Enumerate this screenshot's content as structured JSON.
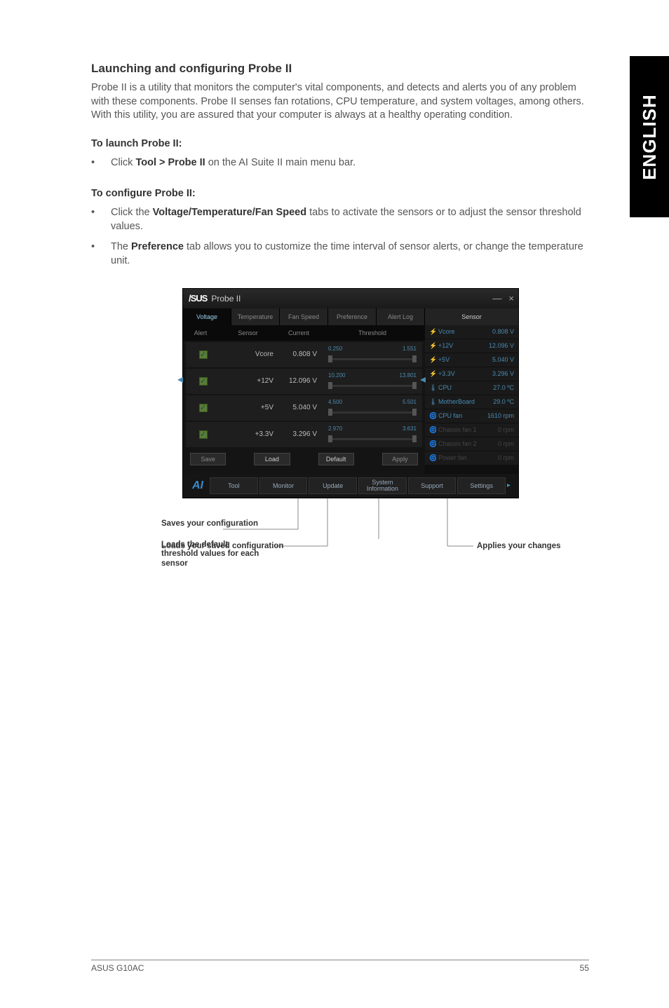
{
  "side_tab": "ENGLISH",
  "heading": "Launching and configuring Probe II",
  "intro": "Probe II is a utility that monitors the computer's vital components, and detects and alerts you of any problem with these components. Probe II senses fan rotations, CPU temperature, and system voltages, among others. With this utility, you are assured that your computer is always at a healthy operating condition.",
  "launch_head": "To launch Probe II:",
  "launch_item_prefix": "Click ",
  "launch_item_bold": "Tool > Probe II",
  "launch_item_suffix": " on the AI Suite II main menu bar.",
  "config_head": "To configure Probe II:",
  "config_item1_prefix": "Click the ",
  "config_item1_bold": "Voltage/Temperature/Fan Speed",
  "config_item1_suffix": " tabs to activate the sensors or to adjust the sensor threshold values.",
  "config_item2_prefix": "The ",
  "config_item2_bold": "Preference",
  "config_item2_suffix": " tab allows you to customize the time interval of sensor alerts, or change the temperature unit.",
  "probe": {
    "logo": "/SUS",
    "title": "Probe II",
    "min": "—",
    "close": "×",
    "tabs": [
      "Voltage",
      "Temperature",
      "Fan Speed",
      "Preference",
      "Alert Log"
    ],
    "cols": {
      "alert": "Alert",
      "sensor": "Sensor",
      "current": "Current",
      "threshold": "Threshold"
    },
    "rows": [
      {
        "name": "Vcore",
        "val": "0.808 V",
        "lo": "0.250",
        "hi": "1.551"
      },
      {
        "name": "+12V",
        "val": "12.096 V",
        "lo": "10.200",
        "hi": "13.801"
      },
      {
        "name": "+5V",
        "val": "5.040 V",
        "lo": "4.500",
        "hi": "5.501"
      },
      {
        "name": "+3.3V",
        "val": "3.296 V",
        "lo": "2.970",
        "hi": "3.631"
      }
    ],
    "btns": {
      "save": "Save",
      "load": "Load",
      "default": "Default",
      "apply": "Apply"
    },
    "side_title": "Sensor",
    "side": [
      {
        "icon": "⚡",
        "name": "Vcore",
        "val": "0.808 V",
        "dim": false
      },
      {
        "icon": "⚡",
        "name": "+12V",
        "val": "12.096 V",
        "dim": false
      },
      {
        "icon": "⚡",
        "name": "+5V",
        "val": "5.040 V",
        "dim": false
      },
      {
        "icon": "⚡",
        "name": "+3.3V",
        "val": "3.296 V",
        "dim": false
      },
      {
        "icon": "🌡",
        "name": "CPU",
        "val": "27.0 ºC",
        "dim": false
      },
      {
        "icon": "🌡",
        "name": "MotherBoard",
        "val": "29.0 ºC",
        "dim": false
      },
      {
        "icon": "🌀",
        "name": "CPU fan",
        "val": "1610 rpm",
        "dim": false
      },
      {
        "icon": "🌀",
        "name": "Chassis fan 1",
        "val": "0 rpm",
        "dim": true
      },
      {
        "icon": "🌀",
        "name": "Chassis fan 2",
        "val": "0 rpm",
        "dim": true
      },
      {
        "icon": "🌀",
        "name": "Power fan",
        "val": "0 rpm",
        "dim": true
      }
    ],
    "bottom": {
      "logo": "AI",
      "items": [
        "Tool",
        "Monitor",
        "Update",
        "System Information",
        "Support",
        "Settings"
      ]
    }
  },
  "anno": {
    "saves": "Saves your configuration",
    "loads": "Loads your saved configuration",
    "default": "Loads the default threshold values for each sensor",
    "apply": "Applies your changes"
  },
  "footer": {
    "left": "ASUS G10AC",
    "right": "55"
  }
}
